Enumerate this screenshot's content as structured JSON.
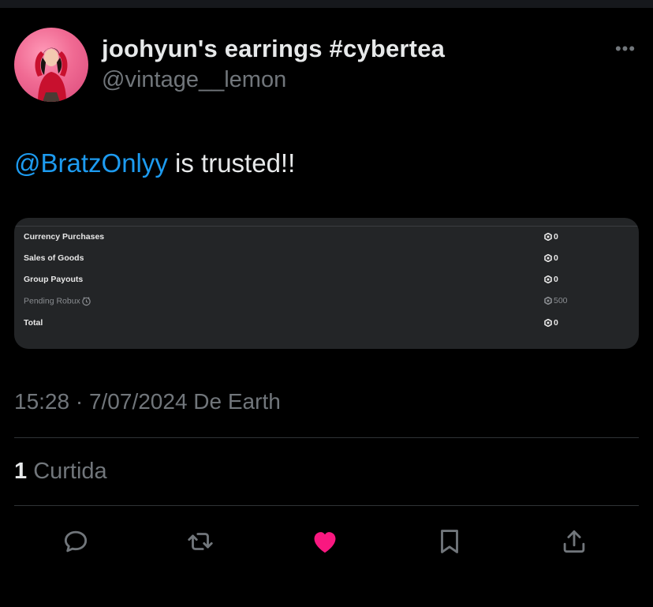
{
  "author": {
    "display_name": "joohyun's earrings #cybertea",
    "handle": "@vintage__lemon"
  },
  "tweet": {
    "mention": "@BratzOnlyy",
    "text": " is trusted!!"
  },
  "media": {
    "rows": [
      {
        "label": "Currency Purchases",
        "amount": "0"
      },
      {
        "label": "Sales of Goods",
        "amount": "0"
      },
      {
        "label": "Group Payouts",
        "amount": "0"
      },
      {
        "label": "Pending Robux",
        "amount": "500"
      },
      {
        "label": "Total",
        "amount": "0"
      }
    ]
  },
  "meta": {
    "timestamp": "15:28 · 7/07/2024 De Earth"
  },
  "likes": {
    "count": "1",
    "label": " Curtida"
  },
  "actions": {
    "icons": [
      "reply-icon",
      "retweet-icon",
      "like-icon",
      "bookmark-icon",
      "share-icon"
    ],
    "like_color": "#f91880",
    "icon_color": "#71767b"
  },
  "colors": {
    "background": "#000000",
    "link": "#1d9bf0",
    "secondary": "#71767b"
  }
}
